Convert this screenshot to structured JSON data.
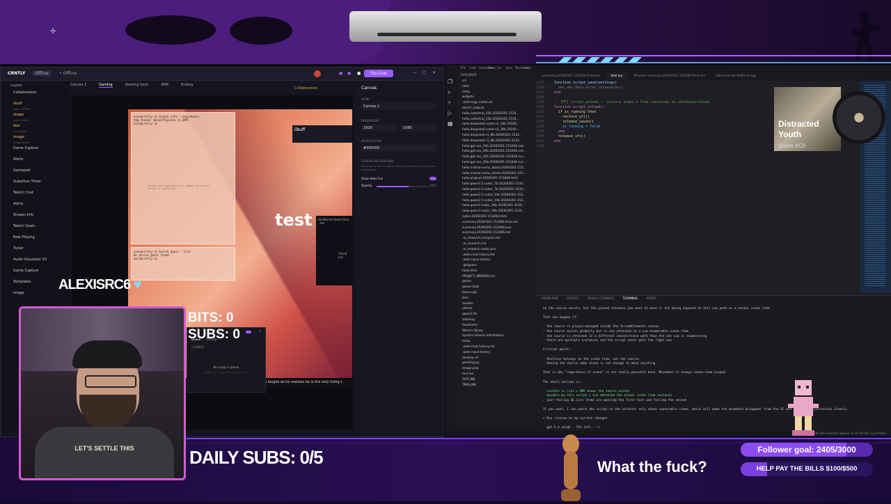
{
  "obs": {
    "app_name": "CRNTLY",
    "badge": "Offline",
    "go_live": "Go Live",
    "collab": "Collaborators",
    "canvas_label": "Canvas 1",
    "tabs": [
      "Canvas 1",
      "Gaming",
      "Starting Soon",
      "BRB",
      "Ending"
    ],
    "layers_title": "Layers",
    "layers": [
      {
        "name": "Collaborators",
        "sub": ""
      },
      {
        "name": "ilbuff",
        "sub": "ilbuff · ACTIVE"
      },
      {
        "name": "shape",
        "sub": "Layer visible"
      },
      {
        "name": "test",
        "sub": "Text visible"
      },
      {
        "name": "image",
        "sub": "Image visible"
      },
      {
        "name": "Game Capture",
        "sub": ""
      },
      {
        "name": "Alerts",
        "sub": ""
      },
      {
        "name": "Gamepad",
        "sub": ""
      },
      {
        "name": "Subathon Timer",
        "sub": ""
      },
      {
        "name": "Twitch Chat",
        "sub": ""
      },
      {
        "name": "Alerts",
        "sub": ""
      },
      {
        "name": "Stream Info",
        "sub": ""
      },
      {
        "name": "Twitch Goals",
        "sub": ""
      },
      {
        "name": "Now Playing",
        "sub": ""
      },
      {
        "name": "Ticker",
        "sub": ""
      },
      {
        "name": "Audio Visualizer V2",
        "sub": ""
      },
      {
        "name": "Game Capture",
        "sub": ""
      },
      {
        "name": "Templates",
        "sub": ""
      },
      {
        "name": "Image",
        "sub": ""
      }
    ],
    "preview_terminal_1": "user@crntly:~$ twitch info --tag=cheese\ntag_cheese: NiceofTipeson [1,3##]\nuser@crntly:~$",
    "preview_terminal_2": "user@crntly:~$ twitch goals --list\nNo active goals found\nuser@crntly:~$",
    "preview_placeholder": "Stream chat messages will appear here once Twitch is connected",
    "preview_test": "test",
    "ilbuff_label": "ilbuff",
    "dark_box_title": "HeliStored Demo Pork - Isd",
    "dark_box_timer": "Timed out",
    "scroll_text": "p laughs as he realizes he is the only living c",
    "canvas_panel": {
      "title": "Canvas",
      "name_label": "NAME",
      "name_value": "Canvas 1",
      "dim_label": "DIMENSIONS",
      "width": "1920",
      "height": "1080",
      "bg_label": "BACKGROUND",
      "bg_value": "#000000",
      "stream_bg_label": "STREAM BACKGROUND",
      "stream_bg_desc": "When you're live on Twitch, show your stream as the canvas background",
      "show_when_live": "Show when live",
      "opacity_label": "Opacity",
      "opacity_value": "60%"
    },
    "queue": {
      "tab_queue": "Queue",
      "tab_settings": "Settings",
      "songs": "0 SONGS",
      "empty": "No songs in queue",
      "hint": "Viewers can request songs with !sr in chat"
    }
  },
  "vscode": {
    "menu": [
      "File",
      "Edit",
      "Selection",
      "View",
      "Go",
      "Run",
      "Terminal",
      "Help"
    ],
    "explorer_title": "EXPLORER",
    "tree": [
      "src",
      "html",
      "Unity",
      "widgets",
      ".aider.tags.cache.v4",
      "bench_outputs",
      "hello.codestral_22b.20260301-1534...",
      "hello.codestral_22b.20260301-1534...",
      "hello.deepseek-coder-v2_16b.20260...",
      "hello.deepseek-coder-v2_16b.20260...",
      "hello.deepseek-r1_8b.20260301-1534...",
      "hello.deepseek-r1_8b.20260301-1534...",
      "hello.gpt-oss_20b.20260301-153406.raw",
      "hello.gpt-oss_20b.20260301-153406.retr...",
      "hello.gpt-oss_20b.20260301-153406.run...",
      "hello.gpt-oss_20b.20260301-153406.run...",
      "hello.mistral-nemo_latest.20260301-153...",
      "hello.mistral-nemo_latest.20260301-153...",
      "hello.original.20260301-153406.html",
      "hello.qwen2.5-coder_7b.20260301-1534...",
      "hello.qwen2.5-coder_7b.20260301-1534...",
      "hello.qwen2.5-coder_14b.20260301-153...",
      "hello.qwen2.5-coder_14b.20260301-153...",
      "hello.qwen3-coder_30b.20260301-1534...",
      "hello.qwen3-coder_30b.20260301-1534...",
      "index.20260301-153406.html",
      "summary.20260301-153406.final.md",
      "summary.20260301-153406.json",
      "summary.20260301-153406.md",
      ".ai_research.compact.md",
      ".ai_research.md",
      ".ai_research.state.json",
      ".aider.chat.history.md",
      ".aider.input.history",
      ".gitignore",
      "hello.html",
      "PROJECT_MEMORY.md",
      "goose",
      "goose-data",
      "llama.cpp",
      "llms",
      "models",
      "ollama",
      "qwen3-tts",
      "seasong",
      "Soulframe",
      "Steam Library",
      "System Volume Information",
      "temp",
      ".aider.chat.history.md",
      ".aider.input.history",
      "desktop.ini",
      "greeting.py",
      "image.png",
      "test.lua",
      "OUTLINE",
      "TIMELINE"
    ],
    "tabs": [
      "summary.20260301-153406.final.md",
      "test.lua",
      "Preview summary.20260301-153406.final.md",
      "llama-server-8080.err.log"
    ],
    "code": [
      {
        "n": "1285",
        "t": "function script_save(settings)",
        "c": "#9cdcfe"
      },
      {
        "n": "1286",
        "t": "  obs.obs_data_array_release(arr)",
        "c": "#808080"
      },
      {
        "n": "1287",
        "t": "end",
        "c": "#c586c0"
      },
      {
        "n": "1288",
        "t": "",
        "c": "#ccc"
      },
      {
        "n": "1289",
        "t": "-- [FF] script_unload -- restore items & free resources on shutdown/reload",
        "c": "#6a9955"
      },
      {
        "n": "1290",
        "t": "function script_unload()",
        "c": "#c586c0"
      },
      {
        "n": "1291",
        "t": "  if is_running then",
        "c": "#dcdcaa"
      },
      {
        "n": "1292",
        "t": "    restore_all()",
        "c": "#dcdcaa"
      },
      {
        "n": "1293",
        "t": "    release_saved()",
        "c": "#dcdcaa"
      },
      {
        "n": "1294",
        "t": "    is_running = false",
        "c": "#4fc1ff"
      },
      {
        "n": "1295",
        "t": "  end",
        "c": "#c586c0"
      },
      {
        "n": "1296",
        "t": "  release_sfx()",
        "c": "#dcdcaa"
      },
      {
        "n": "1297",
        "t": "end",
        "c": "#c586c0"
      },
      {
        "n": "1298",
        "t": "",
        "c": "#ccc"
      }
    ],
    "panel_tabs": [
      "PROBLEMS",
      "OUTPUT",
      "DEBUG CONSOLE",
      "TERMINAL",
      "PORTS"
    ],
    "terminal": [
      "So the source exists, but the placed instance you want to move is not being exposed to this Lua path as a normal scene item.",
      "",
      "That can happen if:",
      "",
      "- the source is plugin-managed inside the StreamElements canvas",
      "- the source exists globally but is not attached to a Lua-enumerable scene item",
      "- the source is attached in a different canvas/scene path than the one Lua is enumerating",
      "- there are multiple instances and the script never gets the right one",
      "",
      "Critical point:",
      "",
      "- Position belongs to the scene item, not the source.",
      "- Seeing the source name alone is not enough to move anything.",
      "",
      "That is why \"regardless of scene\" is not really possible here. Movement is always scene-item-scoped.",
      "",
      "The short version is:",
      "",
      "- visible in list = OBS knows the source exists",
      "- movable by this script = Lua obtained the actual scene item instance",
      "- your failing SE.Live items are passing the first test and failing the second",
      "",
      "If you want, I can patch the script so the selector only shows capturable items, which will make the mismatch disappear from the UI and prove the distinction cleanly.",
      "",
      "> Run /review on my current changes",
      "",
      "  gpt-5.4 xhigh · 75% left · ~\\"
    ],
    "status": "Ln 1296, Col 1 (48 186 selected)   Spaces: 4   UTF-8   CRLF   Lua   Prettier"
  },
  "music": {
    "title": "Distracted Youth",
    "artist": "Quinn XCII"
  },
  "overlay": {
    "username": "ALEXISRC6",
    "bits": "BITS: 0",
    "subs": "SUBS: 0",
    "daily_subs": "DAILY SUBS: 0/5",
    "message": "What the fuck?",
    "follower_goal": "Follower goal: 2405/3000",
    "follower_progress": 0.8017,
    "bills": "HELP PAY THE BILLS  $100/$500",
    "bills_progress": 0.2,
    "shirt_text": "LET'S SETTLE THIS"
  },
  "colors": {
    "accent": "#9b5cff",
    "cam_border": "#d25bd3",
    "goal_purple": "#7b3fe0"
  }
}
